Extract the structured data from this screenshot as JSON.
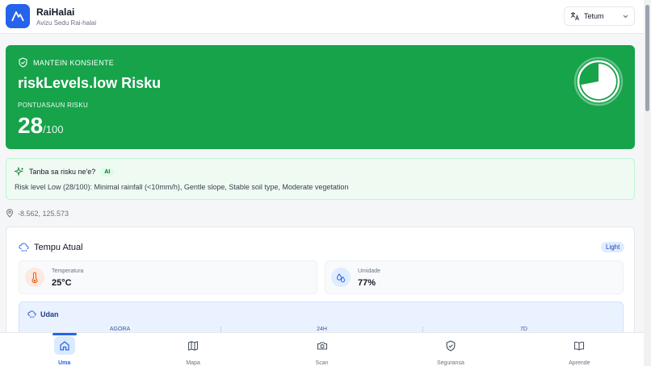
{
  "header": {
    "app_title": "RaiHalai",
    "app_subtitle": "Avizu Sedu Rai-halai",
    "language": "Tetum"
  },
  "risk": {
    "status": "MANTEIN KONSIENTE",
    "level": "riskLevels.low Risku",
    "score_label": "PONTUASAUN RISKU",
    "score": "28",
    "score_max": "/100",
    "score_fraction": 0.28,
    "color": "#16a34a"
  },
  "ai": {
    "question": "Tanba sa risku ne'e?",
    "badge": "AI",
    "explanation": "Risk level Low (28/100): Minimal rainfall (<10mm/h), Gentle slope, Stable soil type, Moderate vegetation"
  },
  "location": {
    "coords": "-8.562, 125.573"
  },
  "weather": {
    "title": "Tempu Atual",
    "badge": "Light",
    "temperature_label": "Temperatura",
    "temperature_value": "25°C",
    "humidity_label": "Umidade",
    "humidity_value": "77%",
    "rain_title": "Udan",
    "rain_columns": [
      "AGORA",
      "24H",
      "7D"
    ]
  },
  "nav": {
    "items": [
      {
        "label": "Uma",
        "icon": "home-icon",
        "active": true
      },
      {
        "label": "Mapa",
        "icon": "map-icon",
        "active": false
      },
      {
        "label": "Scan",
        "icon": "camera-icon",
        "active": false
      },
      {
        "label": "Seguransa",
        "icon": "shield-check-icon",
        "active": false
      },
      {
        "label": "Aprende",
        "icon": "book-icon",
        "active": false
      }
    ]
  },
  "colors": {
    "accent": "#2563eb",
    "risk_low": "#16a34a"
  }
}
